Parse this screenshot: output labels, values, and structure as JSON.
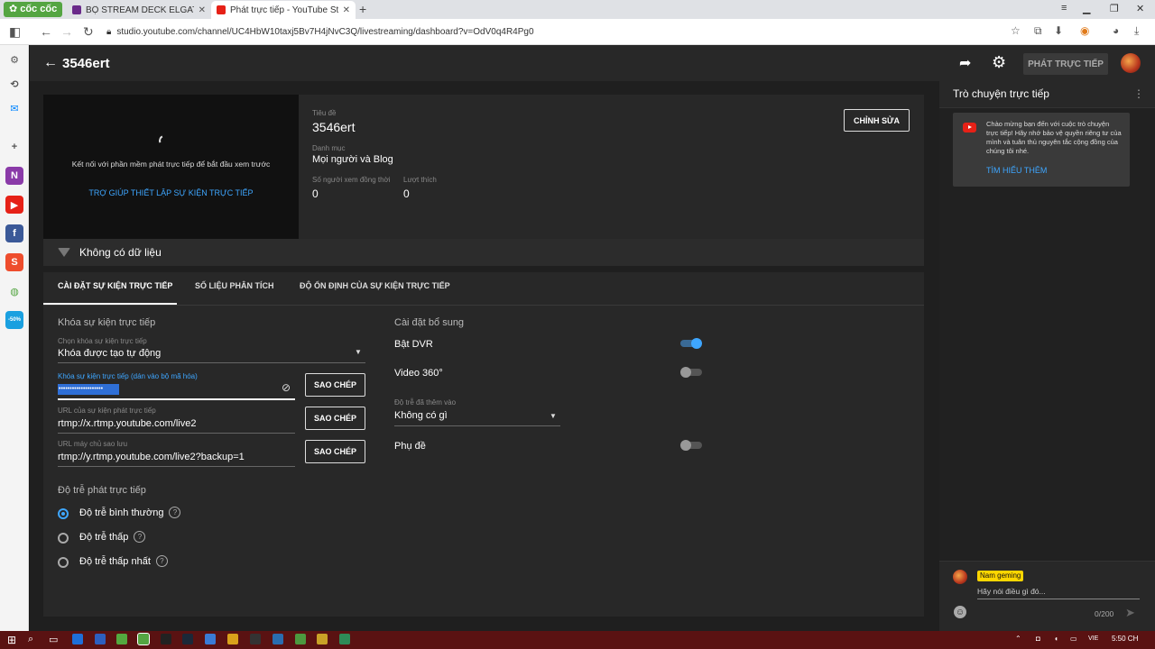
{
  "browser": {
    "brand": "cốc cốc",
    "tabs": [
      {
        "title": "BỘ STREAM DECK ELGATO M",
        "favicon_color": "#6a2a8a"
      },
      {
        "title": "Phát trực tiếp - YouTube Studio",
        "favicon_color": "#e62117"
      }
    ],
    "url": "studio.youtube.com/channel/UC4HbW10taxj5Bv7H4jNvC3Q/livestreaming/dashboard?v=OdV0q4R4Pg0"
  },
  "header": {
    "title": "3546ert",
    "go_live_label": "PHÁT TRỰC TIẾP"
  },
  "preview": {
    "message": "Kết nối với phần mềm phát trực tiếp để bắt đầu xem trước",
    "help_link": "TRỢ GIÚP THIẾT LẬP SỰ KIỆN TRỰC TIẾP",
    "no_data": "Không có dữ liệu"
  },
  "details": {
    "title_label": "Tiêu đề",
    "title_value": "3546ert",
    "category_label": "Danh mục",
    "category_value": "Mọi người và Blog",
    "viewers_label": "Số người xem đồng thời",
    "viewers_value": "0",
    "likes_label": "Lượt thích",
    "likes_value": "0",
    "edit_label": "CHỈNH SỬA"
  },
  "tabs": [
    "CÀI ĐẶT SỰ KIỆN TRỰC TIẾP",
    "SỐ LIỆU PHÂN TÍCH",
    "ĐỘ ỔN ĐỊNH CỦA SỰ KIỆN TRỰC TIẾP"
  ],
  "stream_key": {
    "section_title": "Khóa sự kiện trực tiếp",
    "select_label": "Chọn khóa sự kiện trực tiếp",
    "select_value": "Khóa được tạo tự động",
    "key_label": "Khóa sự kiện trực tiếp (dán vào bộ mã hóa)",
    "key_value": "••••••••••••••••••••",
    "url_label": "URL của sự kiện phát trực tiếp",
    "url_value": "rtmp://x.rtmp.youtube.com/live2",
    "backup_label": "URL máy chủ sao lưu",
    "backup_value": "rtmp://y.rtmp.youtube.com/live2?backup=1",
    "copy_label": "SAO CHÉP"
  },
  "latency": {
    "section_title": "Độ trễ phát trực tiếp",
    "options": [
      {
        "label": "Độ trễ bình thường",
        "selected": true
      },
      {
        "label": "Độ trễ thấp",
        "selected": false
      },
      {
        "label": "Độ trễ thấp nhất",
        "selected": false
      }
    ]
  },
  "additional": {
    "section_title": "Cài đặt bổ sung",
    "dvr_label": "Bật DVR",
    "dvr_on": true,
    "video360_label": "Video 360°",
    "video360_on": false,
    "delay_label": "Độ trễ đã thêm vào",
    "delay_value": "Không có gì",
    "captions_label": "Phụ đề",
    "captions_on": false
  },
  "chat": {
    "title": "Trò chuyện trực tiếp",
    "welcome": "Chào mừng bạn đến với cuộc trò chuyện trực tiếp! Hãy nhớ bảo vệ quyền riêng tư của mình và tuân thủ nguyên tắc cộng đồng của chúng tôi nhé.",
    "learn_more": "TÌM HIỂU THÊM",
    "user_name": "Nam geming",
    "input_placeholder": "Hãy nói điều gì đó...",
    "char_count": "0/200"
  },
  "taskbar": {
    "lang": "VIE",
    "time": "5:50 CH"
  },
  "colors": {
    "accent": "#3ea6ff",
    "youtube_red": "#e62117",
    "dark_bg": "#282828"
  }
}
